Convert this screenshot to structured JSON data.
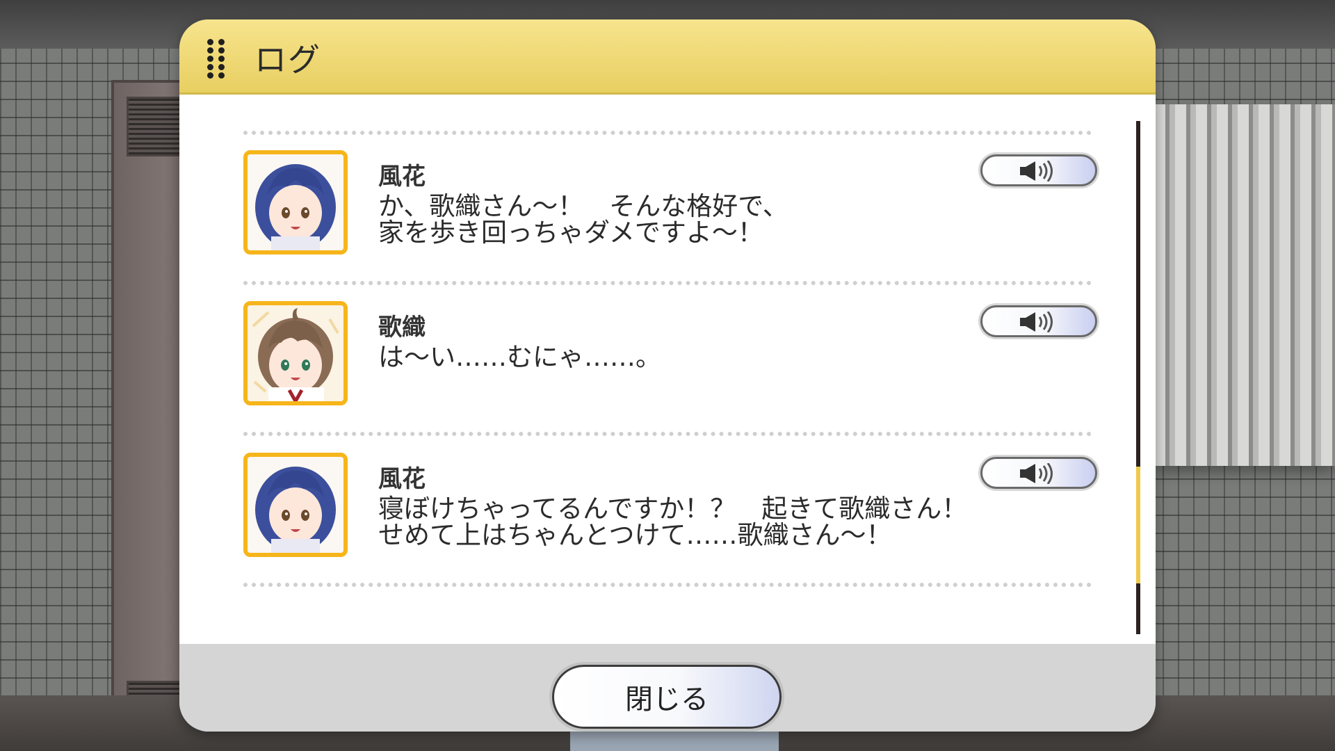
{
  "dialog": {
    "title": "ログ",
    "close_label": "閉じる"
  },
  "log": {
    "entries": [
      {
        "speaker": "風花",
        "text": "か、歌織さん～！　そんな格好で、\n家を歩き回っちゃダメですよ～！",
        "avatar": "fuka-portrait",
        "voice_icon": "speaker-icon"
      },
      {
        "speaker": "歌織",
        "text": "は～い……むにゃ……。",
        "avatar": "kaori-portrait",
        "voice_icon": "speaker-icon"
      },
      {
        "speaker": "風花",
        "text": "寝ぼけちゃってるんですか！？　起きて歌織さん！\nせめて上はちゃんとつけて……歌織さん～！",
        "avatar": "fuka-portrait",
        "voice_icon": "speaker-icon"
      }
    ],
    "scroll_position": 0.85
  },
  "colors": {
    "header": "#efd877",
    "avatar_border": "#f6b51a",
    "scroll_thumb": "#f0c94a",
    "footer": "#d5d5d5"
  }
}
